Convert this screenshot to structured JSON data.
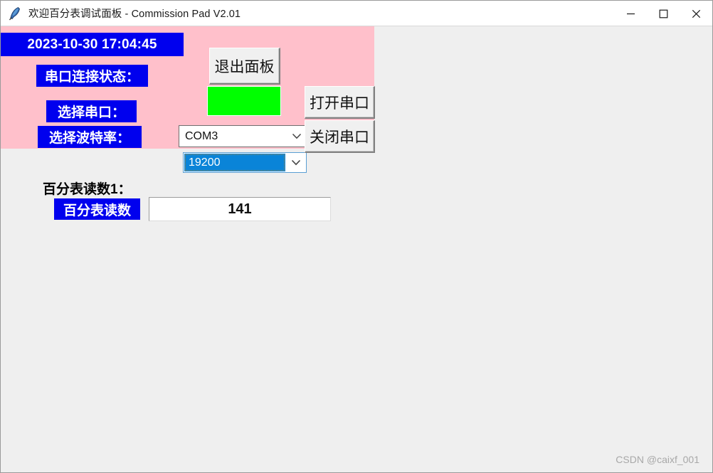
{
  "window": {
    "title": "欢迎百分表调试面板 - Commission Pad V2.01",
    "app_icon": "feather-icon",
    "controls": {
      "minimize": "minimize-icon",
      "maximize": "maximize-icon",
      "close": "close-icon"
    }
  },
  "colors": {
    "panel_background": "#ffc0cb",
    "label_background": "#0000ee",
    "label_foreground": "#ffffff",
    "status_connected": "#00ff00",
    "client_background": "#efefef",
    "combo_selection": "#0a84d8"
  },
  "panel": {
    "datetime": "2023-10-30 17:04:45",
    "connection_status_label": "串口连接状态：",
    "connection_status_value": "connected",
    "select_port_label": "选择串口：",
    "select_baud_label": "选择波特率：",
    "exit_button": "退出面板",
    "open_port_button": "打开串口",
    "close_port_button": "关闭串口",
    "port_combo": {
      "value": "COM3",
      "arrow": "chevron-down-icon"
    },
    "baud_combo": {
      "value": "19200",
      "arrow": "chevron-down-icon"
    }
  },
  "reading": {
    "section_title": "百分表读数1：",
    "label": "百分表读数",
    "value": "141"
  },
  "watermark": "CSDN @caixf_001"
}
